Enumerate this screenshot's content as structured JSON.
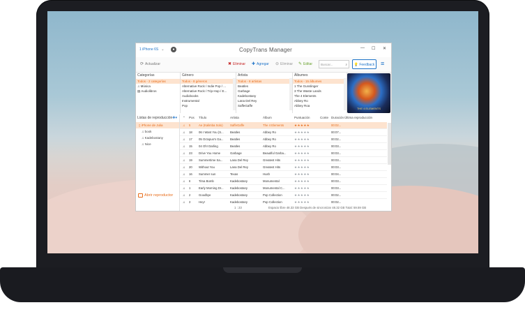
{
  "window": {
    "device": "1 iPhone 6S",
    "title": "CopyTrans Manager",
    "controls": [
      "—",
      "☐",
      "✕"
    ]
  },
  "toolbar": {
    "refresh": "Actualizar",
    "delete": "Eliminar",
    "add": "Agregar",
    "clear": "Eliminar",
    "edit": "Editar",
    "search_placeholder": "Buscar...",
    "feedback": "Feedback"
  },
  "panes": {
    "categories": {
      "title": "Categorías",
      "items": [
        "Todos - 2 categorías",
        "Música",
        "Audiolibros"
      ]
    },
    "genres": {
      "title": "Género",
      "items": [
        "Todos - 8 géneros",
        "Alternative Rock / Indie Pop / ...",
        "Alternative Rock / Trip-Hop / E...",
        "Audiobooks",
        "Instrumental",
        "Pop"
      ]
    },
    "artists": {
      "title": "Artista",
      "items": [
        "Todos - 8 artistas",
        "Beatles",
        "Garbage",
        "Kadebostany",
        "Lana Del Rey",
        "SaffeGaffe"
      ]
    },
    "albums": {
      "title": "Álbumes",
      "items": [
        "Todos - 15 álbumes",
        "1 The Gunslinger",
        "3 The Waste Lands",
        "The 4 Elements",
        "Abbey Ro",
        "Abbey Roa"
      ]
    },
    "art_caption": "THE 4 ELEMENTS"
  },
  "playlists": {
    "title": "Listas de reproducción",
    "items": [
      {
        "label": "iPhone de Julia",
        "selected": true,
        "sub": false
      },
      {
        "label": "book",
        "selected": false,
        "sub": true
      },
      {
        "label": "Kadebostany",
        "selected": false,
        "sub": true
      },
      {
        "label": "Nice",
        "selected": false,
        "sub": true
      }
    ],
    "open_button": "Abrir reproductor"
  },
  "track_headers": [
    "Pos",
    "Título",
    "Artista",
    "Álbum",
    "Puntuación",
    "Conte",
    "Duración",
    "Última reproducción"
  ],
  "tracks": [
    {
      "pos": "5",
      "title": "Ae (Kalimba Solo)",
      "artist": "SaffeGaffe",
      "album": "The 4 Elements",
      "rating": "★★★★★",
      "duration": "00:02..."
    },
    {
      "pos": "18",
      "title": "06 I Want You (S...",
      "artist": "Beatles",
      "album": "Abbey Ro",
      "rating": "★★★★★",
      "duration": "00:07..."
    },
    {
      "pos": "17",
      "title": "05 Octopus's Ga...",
      "artist": "Beatles",
      "album": "Abbey Ro",
      "rating": "★★★★★",
      "duration": "00:02..."
    },
    {
      "pos": "15",
      "title": "04 Oh! Darling",
      "artist": "Beatles",
      "album": "Abbey Ro",
      "rating": "★★★★★",
      "duration": "00:03..."
    },
    {
      "pos": "23",
      "title": "Drive You Home",
      "artist": "Garbage",
      "album": "Beautiful Garba...",
      "rating": "★★★★★",
      "duration": "00:03..."
    },
    {
      "pos": "19",
      "title": "Summertime Sa...",
      "artist": "Lana Del Rey",
      "album": "Greatest Hits",
      "rating": "★★★★★",
      "duration": "00:03..."
    },
    {
      "pos": "20",
      "title": "Without You",
      "artist": "Lana Del Rey",
      "album": "Greatest Hits",
      "rating": "★★★★★",
      "duration": "00:03..."
    },
    {
      "pos": "16",
      "title": "Summer sun",
      "artist": "Texas",
      "album": "Hush",
      "rating": "★★★★★",
      "duration": "00:04..."
    },
    {
      "pos": "6",
      "title": "Tima Bomb",
      "artist": "Kadebostany",
      "album": "Monumental",
      "rating": "★★★★★",
      "duration": "00:03..."
    },
    {
      "pos": "1",
      "title": "Early Morning Dr...",
      "artist": "Kadebostany",
      "album": "Monumental C...",
      "rating": "★★★★★",
      "duration": "00:03..."
    },
    {
      "pos": "2",
      "title": "Goodbye",
      "artist": "Kadebostany",
      "album": "Pop Collection",
      "rating": "★★★★★",
      "duration": "00:02..."
    },
    {
      "pos": "3",
      "title": "Hey!",
      "artist": "Kadebostany",
      "album": "Pop Collection",
      "rating": "★★★★★",
      "duration": "00:02..."
    }
  ],
  "status": {
    "count": "1 : 23",
    "space": "Espacio libre 48.33 GB Después de sincronizar 48.32 GB Total: 59.59 GB"
  },
  "colors": {
    "accent": "#1e73c8",
    "selection": "#e86e1c",
    "selection_bg": "#fde3cf"
  }
}
